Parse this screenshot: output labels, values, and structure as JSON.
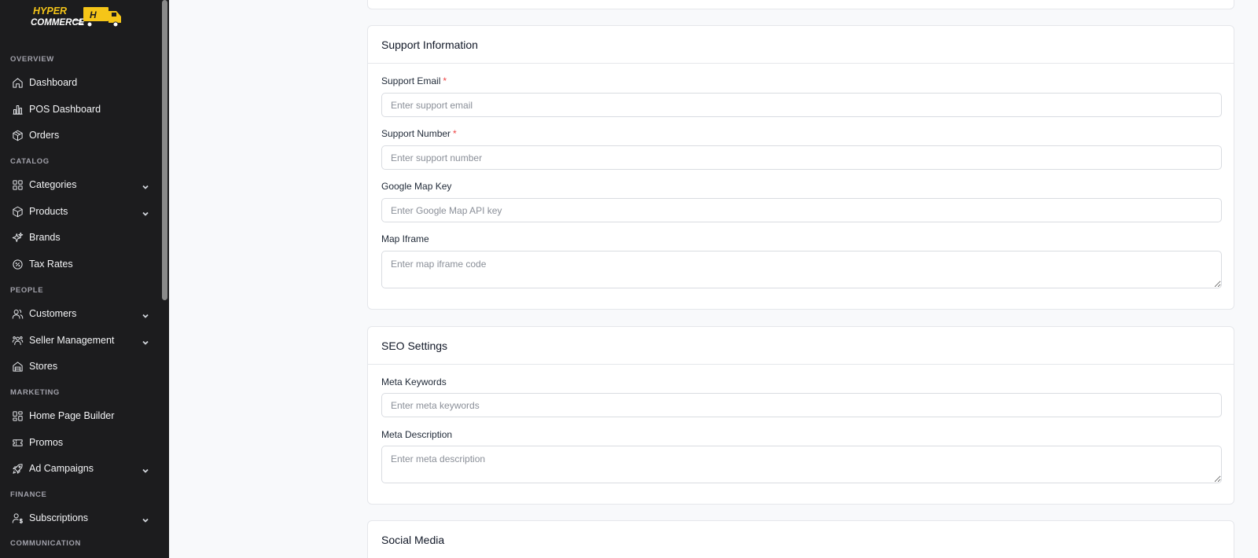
{
  "brand": {
    "logo_line1": "HYPER",
    "logo_line2": "COMMERCE",
    "logo_badge": "H"
  },
  "sidebar": {
    "sections": {
      "overview": "OVERVIEW",
      "catalog": "CATALOG",
      "people": "PEOPLE",
      "marketing": "MARKETING",
      "finance": "FINANCE",
      "communication": "COMMUNICATION"
    },
    "items": {
      "dashboard": "Dashboard",
      "pos_dashboard": "POS Dashboard",
      "orders": "Orders",
      "categories": "Categories",
      "products": "Products",
      "brands": "Brands",
      "tax_rates": "Tax Rates",
      "customers": "Customers",
      "seller_management": "Seller Management",
      "stores": "Stores",
      "home_page_builder": "Home Page Builder",
      "promos": "Promos",
      "ad_campaigns": "Ad Campaigns",
      "subscriptions": "Subscriptions"
    }
  },
  "support": {
    "title": "Support Information",
    "email_label": "Support Email",
    "email_placeholder": "Enter support email",
    "number_label": "Support Number",
    "number_placeholder": "Enter support number",
    "map_key_label": "Google Map Key",
    "map_key_placeholder": "Enter Google Map API key",
    "iframe_label": "Map Iframe",
    "iframe_placeholder": "Enter map iframe code",
    "required_mark": "*"
  },
  "seo": {
    "title": "SEO Settings",
    "keywords_label": "Meta Keywords",
    "keywords_placeholder": "Enter meta keywords",
    "description_label": "Meta Description",
    "description_placeholder": "Enter meta description"
  },
  "social": {
    "title": "Social Media"
  },
  "colors": {
    "sidebar_bg": "#1c1c1e",
    "page_bg": "#f8f9fb",
    "required": "#ef4444",
    "logo_yellow": "#f5c518"
  }
}
